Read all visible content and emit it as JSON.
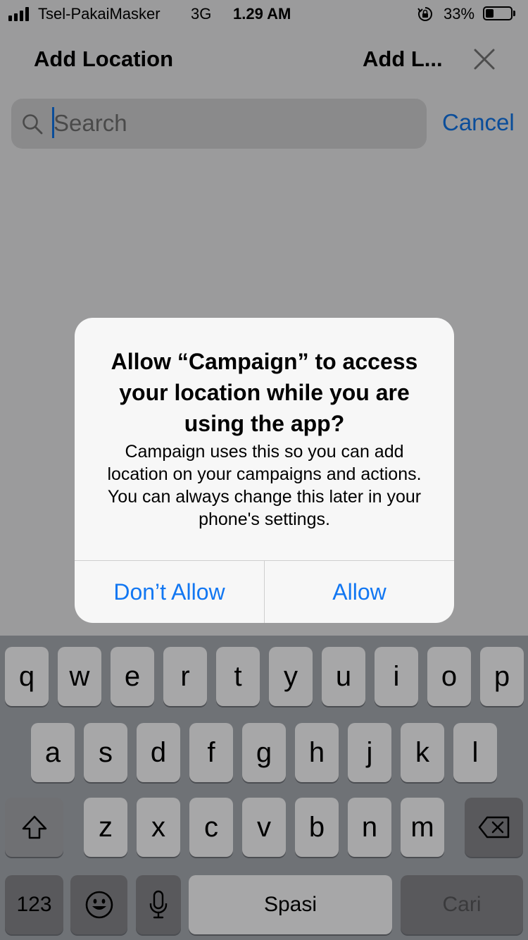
{
  "status_bar": {
    "carrier": "Tsel-PakaiMasker",
    "network": "3G",
    "time": "1.29 AM",
    "battery_percent": "33%",
    "battery_level": 0.33
  },
  "header": {
    "title": "Add Location",
    "title_truncated": "Add L...",
    "close_icon": "close-icon"
  },
  "search": {
    "placeholder": "Search",
    "value": "",
    "cancel_label": "Cancel"
  },
  "dialog": {
    "title": "Allow “Campaign” to access your location while you are using the app?",
    "message": "Campaign uses this so you can add location on your campaigns and actions. You can always change this later in your phone's settings.",
    "deny_label": "Don’t Allow",
    "allow_label": "Allow"
  },
  "keyboard": {
    "row1": [
      "q",
      "w",
      "e",
      "r",
      "t",
      "y",
      "u",
      "i",
      "o",
      "p"
    ],
    "row2": [
      "a",
      "s",
      "d",
      "f",
      "g",
      "h",
      "j",
      "k",
      "l"
    ],
    "row3": [
      "z",
      "x",
      "c",
      "v",
      "b",
      "n",
      "m"
    ],
    "numbers_label": "123",
    "space_label": "Spasi",
    "return_label": "Cari",
    "shift_icon": "shift-icon",
    "delete_icon": "delete-icon",
    "emoji_icon": "emoji-icon",
    "mic_icon": "microphone-icon"
  }
}
